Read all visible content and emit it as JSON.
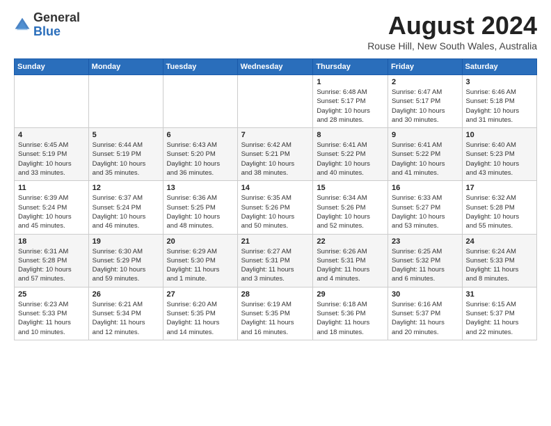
{
  "header": {
    "logo_general": "General",
    "logo_blue": "Blue",
    "month_title": "August 2024",
    "location": "Rouse Hill, New South Wales, Australia"
  },
  "calendar": {
    "headers": [
      "Sunday",
      "Monday",
      "Tuesday",
      "Wednesday",
      "Thursday",
      "Friday",
      "Saturday"
    ],
    "weeks": [
      [
        {
          "day": "",
          "info": ""
        },
        {
          "day": "",
          "info": ""
        },
        {
          "day": "",
          "info": ""
        },
        {
          "day": "",
          "info": ""
        },
        {
          "day": "1",
          "info": "Sunrise: 6:48 AM\nSunset: 5:17 PM\nDaylight: 10 hours\nand 28 minutes."
        },
        {
          "day": "2",
          "info": "Sunrise: 6:47 AM\nSunset: 5:17 PM\nDaylight: 10 hours\nand 30 minutes."
        },
        {
          "day": "3",
          "info": "Sunrise: 6:46 AM\nSunset: 5:18 PM\nDaylight: 10 hours\nand 31 minutes."
        }
      ],
      [
        {
          "day": "4",
          "info": "Sunrise: 6:45 AM\nSunset: 5:19 PM\nDaylight: 10 hours\nand 33 minutes."
        },
        {
          "day": "5",
          "info": "Sunrise: 6:44 AM\nSunset: 5:19 PM\nDaylight: 10 hours\nand 35 minutes."
        },
        {
          "day": "6",
          "info": "Sunrise: 6:43 AM\nSunset: 5:20 PM\nDaylight: 10 hours\nand 36 minutes."
        },
        {
          "day": "7",
          "info": "Sunrise: 6:42 AM\nSunset: 5:21 PM\nDaylight: 10 hours\nand 38 minutes."
        },
        {
          "day": "8",
          "info": "Sunrise: 6:41 AM\nSunset: 5:22 PM\nDaylight: 10 hours\nand 40 minutes."
        },
        {
          "day": "9",
          "info": "Sunrise: 6:41 AM\nSunset: 5:22 PM\nDaylight: 10 hours\nand 41 minutes."
        },
        {
          "day": "10",
          "info": "Sunrise: 6:40 AM\nSunset: 5:23 PM\nDaylight: 10 hours\nand 43 minutes."
        }
      ],
      [
        {
          "day": "11",
          "info": "Sunrise: 6:39 AM\nSunset: 5:24 PM\nDaylight: 10 hours\nand 45 minutes."
        },
        {
          "day": "12",
          "info": "Sunrise: 6:37 AM\nSunset: 5:24 PM\nDaylight: 10 hours\nand 46 minutes."
        },
        {
          "day": "13",
          "info": "Sunrise: 6:36 AM\nSunset: 5:25 PM\nDaylight: 10 hours\nand 48 minutes."
        },
        {
          "day": "14",
          "info": "Sunrise: 6:35 AM\nSunset: 5:26 PM\nDaylight: 10 hours\nand 50 minutes."
        },
        {
          "day": "15",
          "info": "Sunrise: 6:34 AM\nSunset: 5:26 PM\nDaylight: 10 hours\nand 52 minutes."
        },
        {
          "day": "16",
          "info": "Sunrise: 6:33 AM\nSunset: 5:27 PM\nDaylight: 10 hours\nand 53 minutes."
        },
        {
          "day": "17",
          "info": "Sunrise: 6:32 AM\nSunset: 5:28 PM\nDaylight: 10 hours\nand 55 minutes."
        }
      ],
      [
        {
          "day": "18",
          "info": "Sunrise: 6:31 AM\nSunset: 5:28 PM\nDaylight: 10 hours\nand 57 minutes."
        },
        {
          "day": "19",
          "info": "Sunrise: 6:30 AM\nSunset: 5:29 PM\nDaylight: 10 hours\nand 59 minutes."
        },
        {
          "day": "20",
          "info": "Sunrise: 6:29 AM\nSunset: 5:30 PM\nDaylight: 11 hours\nand 1 minute."
        },
        {
          "day": "21",
          "info": "Sunrise: 6:27 AM\nSunset: 5:31 PM\nDaylight: 11 hours\nand 3 minutes."
        },
        {
          "day": "22",
          "info": "Sunrise: 6:26 AM\nSunset: 5:31 PM\nDaylight: 11 hours\nand 4 minutes."
        },
        {
          "day": "23",
          "info": "Sunrise: 6:25 AM\nSunset: 5:32 PM\nDaylight: 11 hours\nand 6 minutes."
        },
        {
          "day": "24",
          "info": "Sunrise: 6:24 AM\nSunset: 5:33 PM\nDaylight: 11 hours\nand 8 minutes."
        }
      ],
      [
        {
          "day": "25",
          "info": "Sunrise: 6:23 AM\nSunset: 5:33 PM\nDaylight: 11 hours\nand 10 minutes."
        },
        {
          "day": "26",
          "info": "Sunrise: 6:21 AM\nSunset: 5:34 PM\nDaylight: 11 hours\nand 12 minutes."
        },
        {
          "day": "27",
          "info": "Sunrise: 6:20 AM\nSunset: 5:35 PM\nDaylight: 11 hours\nand 14 minutes."
        },
        {
          "day": "28",
          "info": "Sunrise: 6:19 AM\nSunset: 5:35 PM\nDaylight: 11 hours\nand 16 minutes."
        },
        {
          "day": "29",
          "info": "Sunrise: 6:18 AM\nSunset: 5:36 PM\nDaylight: 11 hours\nand 18 minutes."
        },
        {
          "day": "30",
          "info": "Sunrise: 6:16 AM\nSunset: 5:37 PM\nDaylight: 11 hours\nand 20 minutes."
        },
        {
          "day": "31",
          "info": "Sunrise: 6:15 AM\nSunset: 5:37 PM\nDaylight: 11 hours\nand 22 minutes."
        }
      ]
    ]
  }
}
